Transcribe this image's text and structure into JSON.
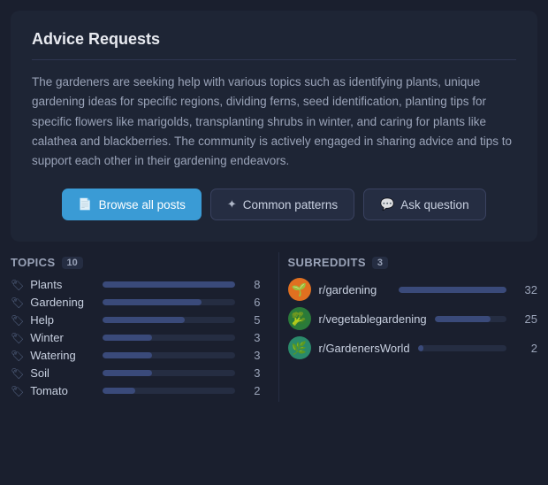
{
  "card": {
    "title": "Advice Requests",
    "description": "The gardeners are seeking help with various topics such as identifying plants, unique gardening ideas for specific regions, dividing ferns, seed identification, planting tips for specific flowers like marigolds, transplanting shrubs in winter, and caring for plants like calathea and blackberries. The community is actively engaged in sharing advice and tips to support each other in their gardening endeavors."
  },
  "buttons": {
    "browse": "Browse all posts",
    "patterns": "Common patterns",
    "ask": "Ask question"
  },
  "topics": {
    "label": "Topics",
    "count": "10",
    "items": [
      {
        "name": "Plants",
        "value": 8,
        "max": 8
      },
      {
        "name": "Gardening",
        "value": 6,
        "max": 8
      },
      {
        "name": "Help",
        "value": 5,
        "max": 8
      },
      {
        "name": "Winter",
        "value": 3,
        "max": 8
      },
      {
        "name": "Watering",
        "value": 3,
        "max": 8
      },
      {
        "name": "Soil",
        "value": 3,
        "max": 8
      },
      {
        "name": "Tomato",
        "value": 2,
        "max": 8
      }
    ]
  },
  "subreddits": {
    "label": "Subreddits",
    "count": "3",
    "items": [
      {
        "name": "r/gardening",
        "value": 32,
        "max": 32,
        "avatar": "🌱",
        "avatar_class": "sub-avatar-orange"
      },
      {
        "name": "r/vegetablegardening",
        "value": 25,
        "max": 32,
        "avatar": "🥦",
        "avatar_class": "sub-avatar-green"
      },
      {
        "name": "r/GardenersWorld",
        "value": 2,
        "max": 32,
        "avatar": "🌿",
        "avatar_class": "sub-avatar-teal"
      }
    ]
  }
}
